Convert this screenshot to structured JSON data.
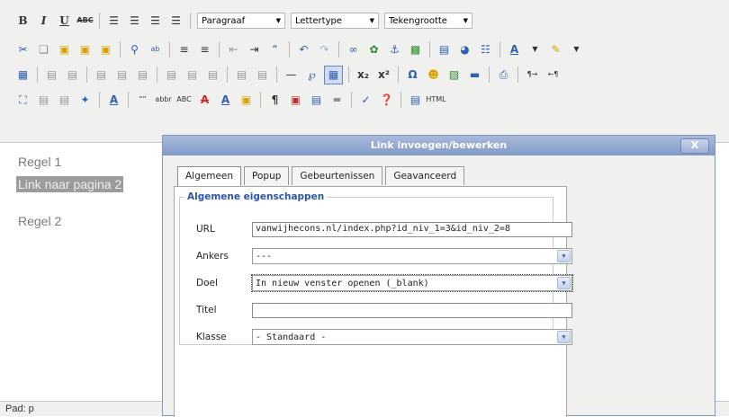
{
  "toolbar": {
    "format_select": "Paragraaf",
    "font_select": "Lettertype",
    "size_select": "Tekengrootte"
  },
  "editor": {
    "line1": "Regel 1",
    "link_text": "Link naar pagina 2",
    "line2": "Regel 2",
    "path": "Pad: p"
  },
  "dialog": {
    "title": "Link invoegen/bewerken",
    "close_label": "X",
    "tabs": [
      "Algemeen",
      "Popup",
      "Gebeurtenissen",
      "Geavanceerd"
    ],
    "legend": "Algemene eigenschappen",
    "fields": {
      "url": {
        "label": "URL",
        "value": "vanwijhecons.nl/index.php?id_niv_1=3&id_niv_2=8"
      },
      "ankers": {
        "label": "Ankers",
        "value": "---"
      },
      "doel": {
        "label": "Doel",
        "value": "In nieuw venster openen (_blank)"
      },
      "titel": {
        "label": "Titel",
        "value": ""
      },
      "klasse": {
        "label": "Klasse",
        "value": "- Standaard -"
      }
    }
  },
  "icons": {
    "row1": [
      "bold-icon",
      "italic-icon",
      "underline-icon",
      "strikethrough-icon",
      "align-left-icon",
      "align-center-icon",
      "align-right-icon",
      "align-justify-icon"
    ],
    "row2": [
      "cut-icon",
      "copy-icon",
      "paste-icon",
      "paste-text-icon",
      "paste-word-icon",
      "find-icon",
      "replace-icon",
      "bullet-list-icon",
      "numbered-list-icon",
      "outdent-icon",
      "indent-icon",
      "blockquote-icon",
      "undo-icon",
      "redo-icon",
      "link-icon",
      "unlink-icon",
      "anchor-icon",
      "image-icon",
      "cleanup-icon",
      "help-icon",
      "code-icon",
      "font-color-icon",
      "highlight-icon"
    ],
    "row3": [
      "table-icon",
      "row-props-icon",
      "cell-props-icon",
      "insert-row-icon",
      "horizontal-rule-icon",
      "remove-format-icon",
      "visual-aid-icon",
      "subscript-icon",
      "superscript-icon",
      "charmap-icon",
      "emoticons-icon",
      "media-icon",
      "advhr-icon",
      "print-icon",
      "ltr-icon",
      "rtl-icon"
    ],
    "row4": [
      "fullscreen-icon",
      "insert-layer-icon",
      "styleprops-icon",
      "cite-icon",
      "abbr-icon",
      "acronym-icon",
      "del-icon",
      "ins-icon",
      "attribs-icon",
      "pilcrow-icon",
      "template-icon",
      "pagebreak-icon",
      "spellcheck-icon",
      "help-icon",
      "html-icon"
    ]
  }
}
